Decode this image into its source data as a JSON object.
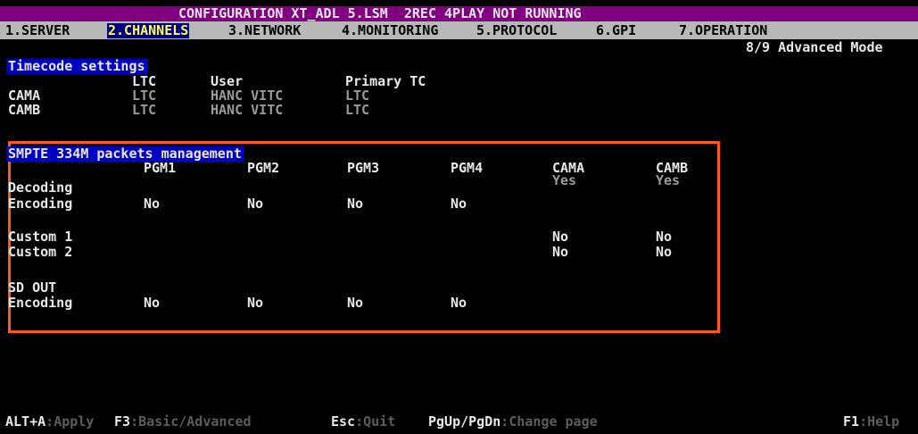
{
  "title": "CONFIGURATION XT_ADL 5.LSM  2REC 4PLAY NOT RUNNING",
  "menu": [
    {
      "label": "1.SERVER"
    },
    {
      "label": "2.CHANNELS",
      "active": true
    },
    {
      "label": "3.NETWORK"
    },
    {
      "label": "4.MONITORING"
    },
    {
      "label": "5.PROTOCOL"
    },
    {
      "label": "6.GPI"
    },
    {
      "label": "7.OPERATION"
    }
  ],
  "page_info": "8/9 Advanced Mode",
  "timecode": {
    "title": "Timecode settings",
    "headers": [
      "LTC",
      "User",
      "Primary TC"
    ],
    "rows": [
      {
        "name": "CAMA",
        "ltc": "LTC",
        "user": "HANC VITC",
        "primary": "LTC"
      },
      {
        "name": "CAMB",
        "ltc": "LTC",
        "user": "HANC VITC",
        "primary": "LTC"
      }
    ]
  },
  "smpte": {
    "title": "SMPTE 334M packets management",
    "headers": [
      "PGM1",
      "PGM2",
      "PGM3",
      "PGM4",
      "CAMA",
      "CAMB"
    ],
    "decoding": {
      "label": "Decoding",
      "cama": "Yes",
      "camb": "Yes"
    },
    "encoding": {
      "label": "Encoding",
      "values": [
        "No",
        "No",
        "No",
        "No"
      ]
    },
    "custom1": {
      "label": "Custom 1",
      "cama": "No",
      "camb": "No"
    },
    "custom2": {
      "label": "Custom 2",
      "cama": "No",
      "camb": "No"
    },
    "sdout_label": "SD OUT",
    "sdout_encoding": {
      "label": "Encoding",
      "values": [
        "No",
        "No",
        "No",
        "No"
      ]
    }
  },
  "status_bar": [
    {
      "key": "ALT+A",
      "sep": ":",
      "desc": "Apply"
    },
    {
      "key": "F3",
      "sep": ":",
      "desc": "Basic/Advanced"
    },
    {
      "key": "Esc",
      "sep": ":",
      "desc": "Quit"
    },
    {
      "key": "PgUp/PgDn",
      "sep": ":",
      "desc": "Change page"
    },
    {
      "key": "F1",
      "sep": ":",
      "desc": "Help"
    }
  ],
  "colors": {
    "title_bg": "#800080",
    "menu_bg": "#b8b8b8",
    "active_tab_bg": "#000080",
    "active_tab_fg": "#ffff55",
    "section_title_bg": "#0000c0",
    "highlight_box": "#ff5a1e"
  }
}
